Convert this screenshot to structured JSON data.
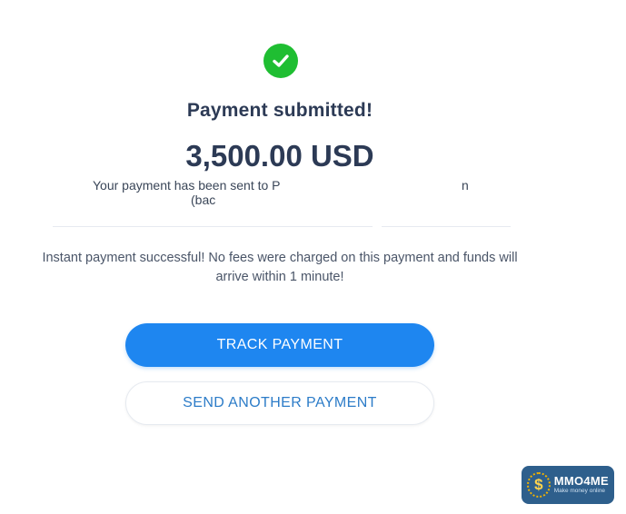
{
  "status": {
    "icon": "check-circle-icon",
    "title": "Payment submitted!",
    "amount": "3,500.00 USD",
    "sent_line_visible": "Your payment has been sent to P",
    "sent_line_tail": "n",
    "sent_line2_visible": "(bac"
  },
  "note": "Instant payment successful! No fees were charged on this payment and funds will arrive within 1 minute!",
  "actions": {
    "track_label": "TRACK PAYMENT",
    "send_another_label": "SEND ANOTHER PAYMENT"
  },
  "watermark": {
    "name": "MMO4ME",
    "tagline": "Make money online",
    "symbol": "$"
  },
  "colors": {
    "success": "#1fbe32",
    "primary": "#1e86f0",
    "text": "#2c3a55"
  }
}
